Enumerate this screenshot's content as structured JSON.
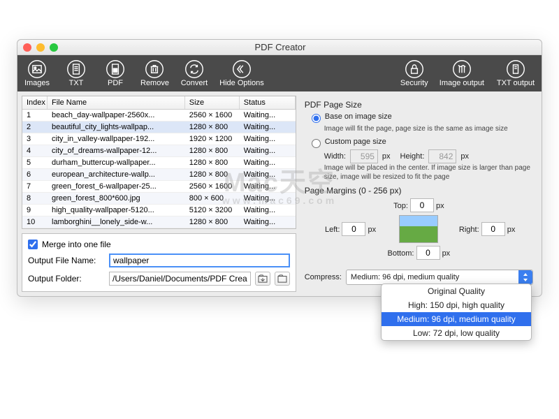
{
  "window": {
    "title": "PDF Creator"
  },
  "toolbar": {
    "images": "Images",
    "txt": "TXT",
    "pdf": "PDF",
    "remove": "Remove",
    "convert": "Convert",
    "hide_options": "Hide Options",
    "security": "Security",
    "image_output": "Image output",
    "txt_output": "TXT output"
  },
  "table": {
    "headers": {
      "index": "Index",
      "filename": "File Name",
      "size": "Size",
      "status": "Status"
    },
    "rows": [
      {
        "idx": "1",
        "name": "beach_day-wallpaper-2560x...",
        "size": "2560 × 1600",
        "status": "Waiting..."
      },
      {
        "idx": "2",
        "name": "beautiful_city_lights-wallpap...",
        "size": "1280 × 800",
        "status": "Waiting..."
      },
      {
        "idx": "3",
        "name": "city_in_valley-wallpaper-192...",
        "size": "1920 × 1200",
        "status": "Waiting..."
      },
      {
        "idx": "4",
        "name": "city_of_dreams-wallpaper-12...",
        "size": "1280 × 800",
        "status": "Waiting..."
      },
      {
        "idx": "5",
        "name": "durham_buttercup-wallpaper...",
        "size": "1280 × 800",
        "status": "Waiting..."
      },
      {
        "idx": "6",
        "name": "european_architecture-wallp...",
        "size": "1280 × 800",
        "status": "Waiting..."
      },
      {
        "idx": "7",
        "name": "green_forest_6-wallpaper-25...",
        "size": "2560 × 1600",
        "status": "Waiting..."
      },
      {
        "idx": "8",
        "name": "green_forest_800*600.jpg",
        "size": "800 × 600",
        "status": "Waiting..."
      },
      {
        "idx": "9",
        "name": "high_quality-wallpaper-5120...",
        "size": "5120 × 3200",
        "status": "Waiting..."
      },
      {
        "idx": "10",
        "name": "lamborghini__lonely_side-w...",
        "size": "1280 × 800",
        "status": "Waiting..."
      }
    ]
  },
  "merge": {
    "label": "Merge into one file",
    "checked": true
  },
  "output_name": {
    "label": "Output File Name:",
    "value": "wallpaper"
  },
  "output_folder": {
    "label": "Output Folder:",
    "value": "/Users/Daniel/Documents/PDF Creator Master"
  },
  "pagesize": {
    "title": "PDF Page Size",
    "base": {
      "label": "Base on image size",
      "desc": "Image will fit the page, page size is the same as image size"
    },
    "custom": {
      "label": "Custom page size",
      "width_label": "Width:",
      "width": "595",
      "height_label": "Height:",
      "height": "842",
      "unit": "px",
      "desc": "Image will be placed in the center. If image size is larger than page size, image will be resized to fit the page"
    }
  },
  "margins": {
    "title": "Page Margins (0 - 256 px)",
    "top_label": "Top:",
    "top": "0",
    "left_label": "Left:",
    "left": "0",
    "right_label": "Right:",
    "right": "0",
    "bottom_label": "Bottom:",
    "bottom": "0",
    "unit": "px"
  },
  "compress": {
    "label": "Compress:",
    "selected": "Medium: 96 dpi, medium quality",
    "options": [
      "Original Quality",
      "High: 150 dpi, high quality",
      "Medium: 96 dpi, medium quality",
      "Low: 72 dpi, low quality"
    ]
  },
  "watermark": {
    "main": "Mac天空",
    "sub": "www.mac69.com"
  }
}
